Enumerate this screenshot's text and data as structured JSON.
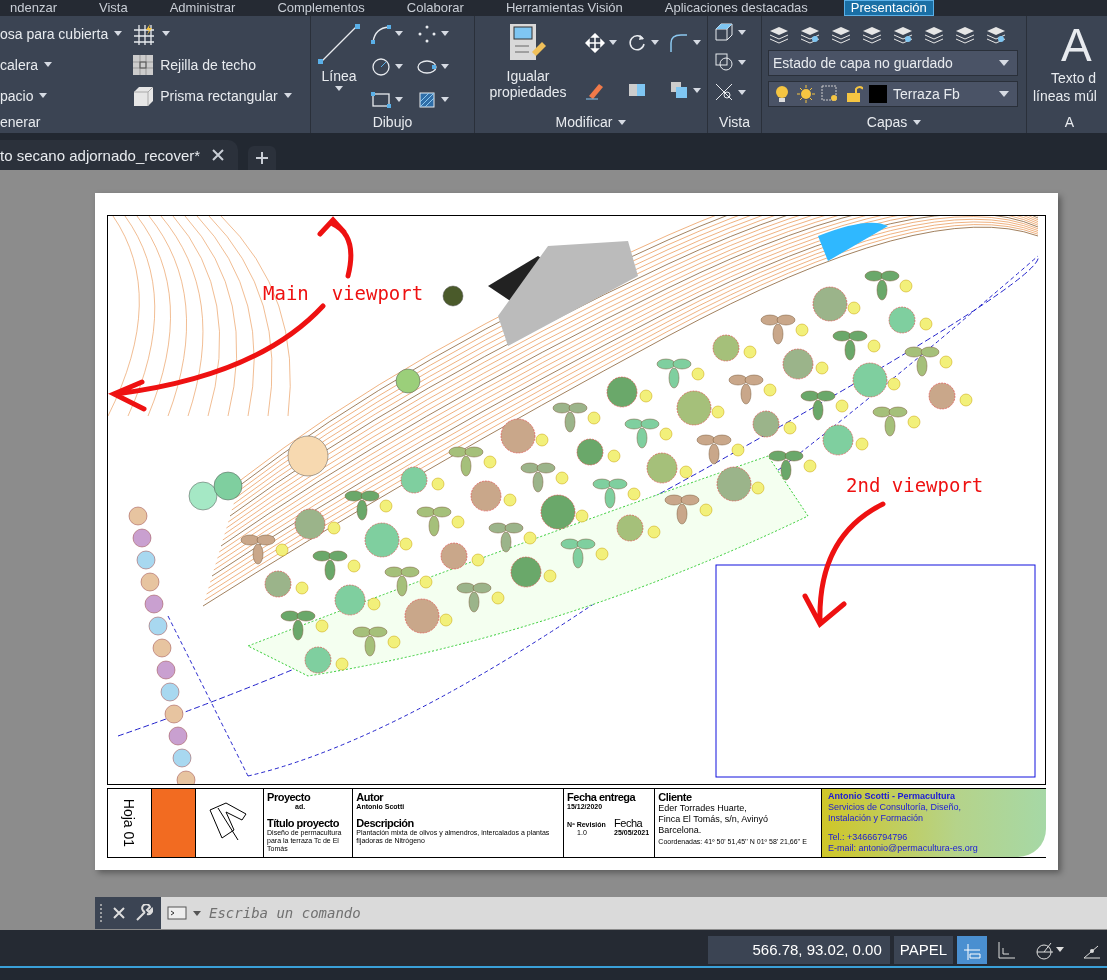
{
  "menu_tabs": [
    {
      "label": "ndenzar",
      "selected": false
    },
    {
      "label": "Vista",
      "selected": false
    },
    {
      "label": "Administrar",
      "selected": false
    },
    {
      "label": "Complementos",
      "selected": false
    },
    {
      "label": "Colaborar",
      "selected": false
    },
    {
      "label": "Herramientas Visión",
      "selected": false
    },
    {
      "label": "Aplicaciones destacadas",
      "selected": false
    },
    {
      "label": "Presentación",
      "selected": true
    }
  ],
  "ribbon": {
    "panels": [
      {
        "kind": "generar",
        "title": "enerar",
        "items": [
          {
            "label": "osa para cubierta"
          },
          {
            "label": "calera"
          },
          {
            "label": "pacio"
          },
          {
            "label": "Rejilla de techo"
          },
          {
            "label": "Prisma rectangular"
          }
        ]
      },
      {
        "kind": "dibujo",
        "title": "Dibujo",
        "items": [
          {
            "label": "Línea"
          }
        ]
      },
      {
        "kind": "modificar",
        "title": "Modificar",
        "items": [
          {
            "label": "Igualar propiedades"
          }
        ]
      },
      {
        "kind": "vista",
        "title": "Vista"
      },
      {
        "kind": "capas",
        "title": "Capas",
        "items": [
          {
            "label": "Estado de capa no guardado"
          },
          {
            "label": "Terraza Fb"
          }
        ]
      },
      {
        "kind": "anotacion",
        "title": "A",
        "items": [
          {
            "label": "A"
          },
          {
            "label": "Texto d"
          },
          {
            "label": "líneas múl"
          }
        ]
      }
    ]
  },
  "document_tabs": [
    {
      "label": "to secano adjornado_recover*",
      "selected": true
    }
  ],
  "sheet": {
    "annotations": [
      {
        "text": "Main  viewport"
      },
      {
        "text": "2nd viewport"
      }
    ],
    "title_block": {
      "sheet_label": "Hoja 01",
      "project": {
        "heading": "Proyecto",
        "value": "ad.",
        "title_heading": "Título proyecto",
        "title": "Diseño de permacultura para la terraza Tc de El Tomás"
      },
      "author": {
        "heading": "Autor",
        "value": "Antonio Scotti",
        "description_heading": "Descripción",
        "description": "Plantación mixta de olivos y almendros, intercalados a plantas fijadoras de Nitrógeno"
      },
      "dates": {
        "delivery_heading": "Fecha entrega",
        "delivery": "15/12/2020",
        "revision_heading": "Nº Revisión",
        "revision": "1.0",
        "date_heading": "Fecha",
        "date": "25/05/2021"
      },
      "client": {
        "heading": "Cliente",
        "lines": [
          "Eder Torrades Huarte,",
          "Finca El Tomás, s/n, Avinyó",
          "Barcelona."
        ],
        "coordinates": "Coordenadas: 41º 50' 51,45'' N  01º 58' 21,66'' E"
      },
      "company": {
        "name": "Antonio Scotti - Permacultura",
        "services": "Servicios de Consultoría, Diseño, Instalación y Formación",
        "phone": "Tel.: +34666794796",
        "email": "E-mail: antonio@permacultura-es.org"
      }
    }
  },
  "command_line": {
    "placeholder": "Escriba un comando"
  },
  "status_bar": {
    "coordinates": "566.78, 93.02, 0.00",
    "space": "PAPEL",
    "toggles": [
      {
        "kind": "grid",
        "on": true
      },
      {
        "kind": "ortho",
        "on": false
      },
      {
        "kind": "polar",
        "on": false
      },
      {
        "kind": "isodraft",
        "on": false
      }
    ]
  }
}
